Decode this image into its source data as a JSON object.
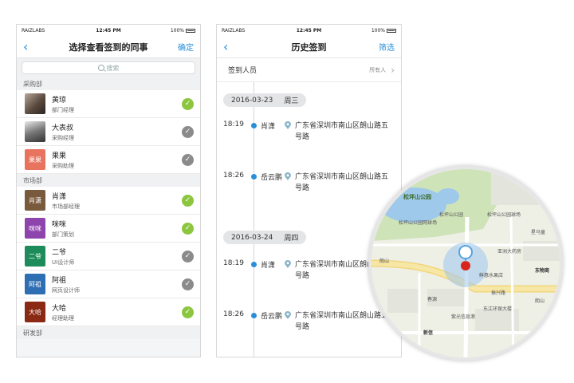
{
  "status": {
    "carrier": "RAIZLABS",
    "time": "12:45 PM",
    "battery": "100%"
  },
  "screen1": {
    "title": "选择查看签到的同事",
    "back": "‹",
    "action": "确定",
    "search_placeholder": "搜索",
    "sections": [
      {
        "name": "采购部",
        "people": [
          {
            "name": "黄琼",
            "role": "部门经理",
            "avatar": "",
            "checked": true
          },
          {
            "name": "大表叔",
            "role": "采购经理",
            "avatar": "",
            "checked": false
          },
          {
            "name": "果果",
            "role": "采购助理",
            "avatar": "果果",
            "color": "#e8735e",
            "checked": false
          }
        ]
      },
      {
        "name": "市场部",
        "people": [
          {
            "name": "肖潇",
            "role": "市场部经理",
            "avatar": "肖潇",
            "color": "#7a5a3c",
            "checked": true
          },
          {
            "name": "咪咪",
            "role": "部门策划",
            "avatar": "咪咪",
            "color": "#8e44ad",
            "checked": true
          },
          {
            "name": "二爷",
            "role": "UI设计师",
            "avatar": "二爷",
            "color": "#1e8c5a",
            "checked": false
          },
          {
            "name": "阿祖",
            "role": "网页设计师",
            "avatar": "阿祖",
            "color": "#2e6fb3",
            "checked": false
          },
          {
            "name": "大哈",
            "role": "经理助理",
            "avatar": "大哈",
            "color": "#8b2a14",
            "checked": true
          }
        ]
      },
      {
        "name": "研发部",
        "people": []
      }
    ]
  },
  "screen2": {
    "title": "历史签到",
    "back": "‹",
    "action": "筛选",
    "person_label": "签到人员",
    "person_value": "所有人",
    "days": [
      {
        "date": "2016-03-23",
        "weekday": "周三",
        "entries": [
          {
            "time": "18:19",
            "name": "肖潇",
            "address": "广东省深圳市南山区朗山路五号路"
          },
          {
            "time": "18:26",
            "name": "岳云鹏",
            "address": "广东省深圳市南山区朗山路五号路"
          }
        ]
      },
      {
        "date": "2016-03-24",
        "weekday": "周四",
        "entries": [
          {
            "time": "18:19",
            "name": "肖潇",
            "address": "广东省深圳市南山区朗山路五号路"
          },
          {
            "time": "18:26",
            "name": "岳云鹏",
            "address": "广东省深圳市南山区朗山路五号路"
          }
        ]
      }
    ]
  },
  "map": {
    "labels": [
      "松坪山公园",
      "松坪山公园网球场",
      "松坪山公园球场",
      "松坪山公园",
      "星马童",
      "亚洲大药房",
      "东物商",
      "鲜惠水果店",
      "朗山",
      "振兴路",
      "春源",
      "东江环保大楼",
      "紫光信息港",
      "新信",
      "朗山"
    ]
  },
  "colors": {
    "accent": "#2a8fd8",
    "check_on": "#8cc63f",
    "check_off": "#8b8b8b",
    "pin": "#d9241b"
  }
}
